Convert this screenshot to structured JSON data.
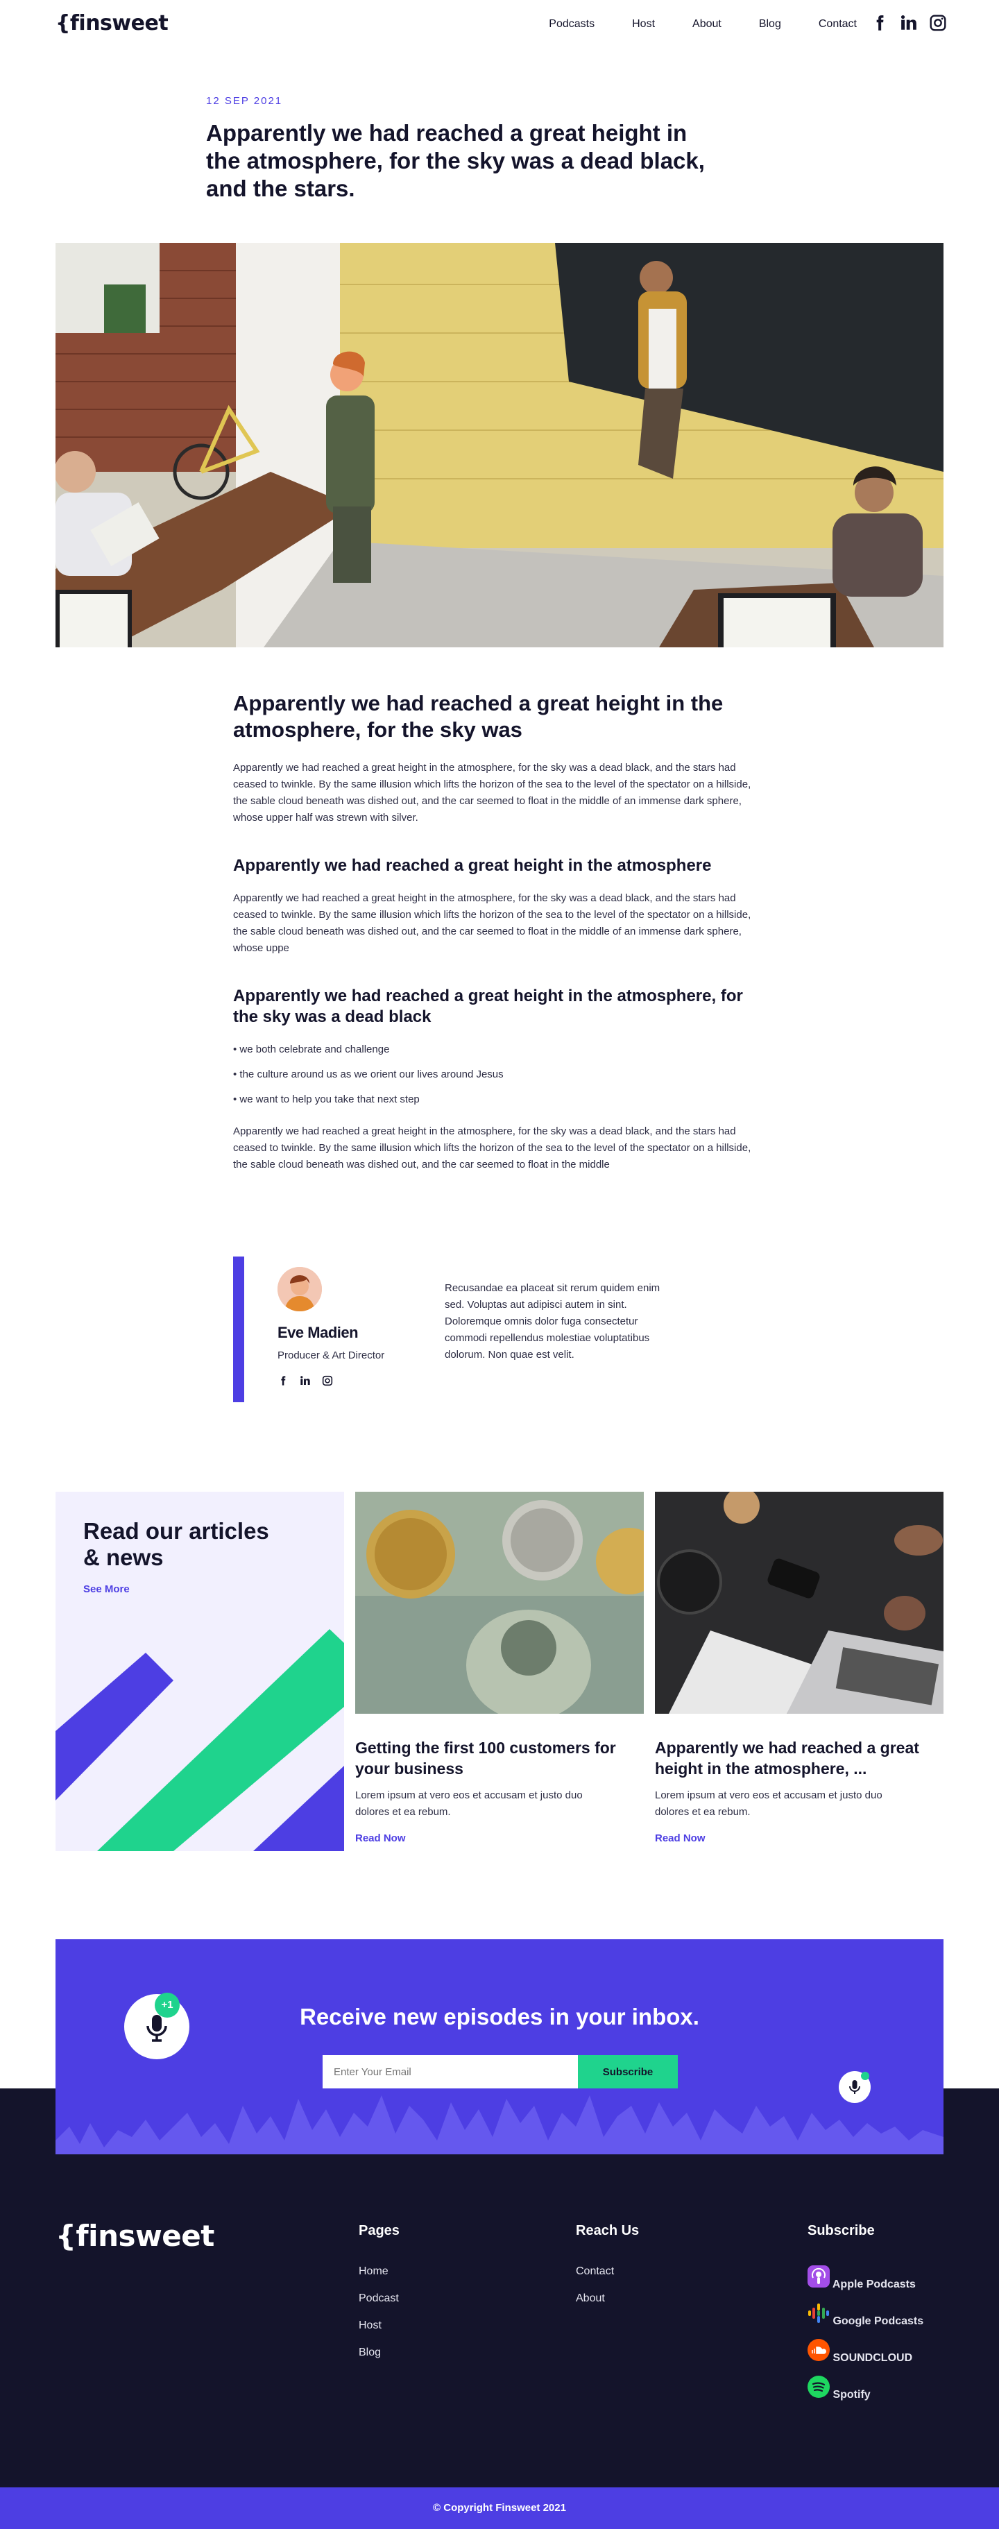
{
  "header": {
    "logo": "{finsweet",
    "nav": [
      "Podcasts",
      "Host",
      "About",
      "Blog",
      "Contact"
    ]
  },
  "post": {
    "date": "12 SEP 2021",
    "title": "Apparently we had reached a great height in the atmosphere, for the sky was a dead black, and the stars."
  },
  "article": {
    "h1": "Apparently we had reached a great height in the atmosphere, for the sky was",
    "p1": "Apparently we had reached a great height in the atmosphere, for the sky was a dead black, and the stars had ceased to twinkle. By the same illusion which lifts the horizon of the sea to the level of the spectator on a hillside, the sable cloud beneath was dished out, and the car seemed to float in the middle of an immense dark sphere, whose upper half was strewn with silver.",
    "h2a": "Apparently we had reached a great height in the atmosphere",
    "p2": "Apparently we had reached a great height in the atmosphere, for the sky was a dead black, and the stars had ceased to twinkle. By the same illusion which lifts the horizon of the sea to the level of the spectator on a hillside, the sable cloud beneath was dished out, and the car seemed to float in the middle of an immense dark sphere, whose uppe",
    "h2b": "Apparently we had reached a great height in the atmosphere, for the sky was a dead black",
    "bullets": [
      "we both celebrate and challenge",
      "the culture around us as we orient our lives around Jesus",
      "we want to help you take that next step"
    ],
    "p3": "Apparently we had reached a great height in the atmosphere, for the sky was a dead black, and the stars had ceased to twinkle. By the same illusion which lifts the horizon of the sea to the level of the spectator on a hillside, the sable cloud beneath was dished out, and the car seemed to float in the middle"
  },
  "author": {
    "name": "Eve Madien",
    "role": "Producer & Art Director",
    "bio": "Recusandae ea placeat sit rerum quidem enim sed. Voluptas aut adipisci autem in sint. Doloremque omnis dolor fuga consectetur commodi repellendus molestiae voluptatibus dolorum. Non quae est velit."
  },
  "news": {
    "heading": "Read our articles & news",
    "see_more": "See More",
    "cards": [
      {
        "title": "Getting the first 100 customers for your business",
        "text": "Lorem ipsum at vero eos et accusam et justo duo dolores et ea rebum.",
        "link": "Read Now"
      },
      {
        "title": "Apparently we had reached a great height in the atmosphere, ...",
        "text": "Lorem ipsum at vero eos et accusam et justo duo dolores et ea rebum.",
        "link": "Read Now"
      }
    ]
  },
  "subscribe": {
    "heading": "Receive new episodes in your inbox.",
    "placeholder": "Enter Your Email",
    "button": "Subscribe",
    "badge": "+1"
  },
  "footer": {
    "logo": "{finsweet",
    "pages_title": "Pages",
    "pages": [
      "Home",
      "Podcast",
      "Host",
      "Blog"
    ],
    "reach_title": "Reach Us",
    "reach": [
      "Contact",
      "About"
    ],
    "subscribe_title": "Subscribe",
    "platforms": [
      "Apple Podcasts",
      "Google Podcasts",
      "SOUNDCLOUD",
      "Spotify"
    ],
    "copyright": "© Copyright Finsweet 2021"
  },
  "colors": {
    "primary": "#4d3ee3",
    "accent": "#1fd38d",
    "dark": "#14142b",
    "promo_bg": "#f2f0fe"
  },
  "icons": [
    "facebook-icon",
    "linkedin-icon",
    "instagram-icon",
    "microphone-icon",
    "apple-podcasts-icon",
    "google-podcasts-icon",
    "soundcloud-icon",
    "spotify-icon"
  ]
}
